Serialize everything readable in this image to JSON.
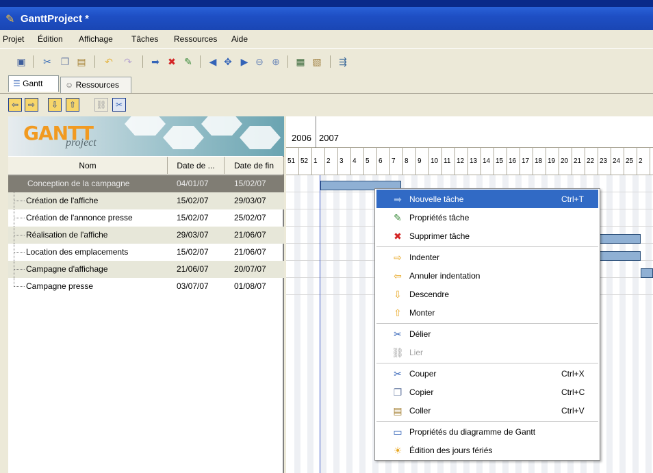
{
  "window": {
    "title": "GanttProject *"
  },
  "menu": [
    "Projet",
    "Édition",
    "Affichage",
    "Tâches",
    "Ressources",
    "Aide"
  ],
  "tabs": [
    {
      "label": "Gantt"
    },
    {
      "label": "Ressources"
    }
  ],
  "logo": {
    "brand": "GANTT",
    "sub": "project"
  },
  "table": {
    "headers": [
      "Nom",
      "Date de ...",
      "Date de fin"
    ],
    "rows": [
      {
        "name": "Conception de la campagne",
        "start": "04/01/07",
        "end": "15/02/07"
      },
      {
        "name": "Création de l'affiche",
        "start": "15/02/07",
        "end": "29/03/07"
      },
      {
        "name": "Création de l'annonce presse",
        "start": "15/02/07",
        "end": "25/02/07"
      },
      {
        "name": "Réalisation de l'affiche",
        "start": "29/03/07",
        "end": "21/06/07"
      },
      {
        "name": "Location des emplacements",
        "start": "15/02/07",
        "end": "21/06/07"
      },
      {
        "name": "Campagne d'affichage",
        "start": "21/06/07",
        "end": "20/07/07"
      },
      {
        "name": "Campagne presse",
        "start": "03/07/07",
        "end": "01/08/07"
      }
    ]
  },
  "timeline": {
    "year_prev": "2006",
    "year": "2007",
    "weeks": [
      "51",
      "52",
      "1",
      "2",
      "3",
      "4",
      "5",
      "6",
      "7",
      "8",
      "9",
      "10",
      "11",
      "12",
      "13",
      "14",
      "15",
      "16",
      "17",
      "18",
      "19",
      "20",
      "21",
      "22",
      "23",
      "24",
      "25",
      "2"
    ]
  },
  "context_menu": {
    "items": [
      {
        "label": "Nouvelle tâche",
        "shortcut": "Ctrl+T",
        "icon": "arrow-right-icon"
      },
      {
        "label": "Propriétés tâche",
        "shortcut": "",
        "icon": "task-properties-icon"
      },
      {
        "label": "Supprimer tâche",
        "shortcut": "",
        "icon": "delete-icon"
      },
      {
        "label": "Indenter",
        "shortcut": "",
        "icon": "indent-icon"
      },
      {
        "label": "Annuler indentation",
        "shortcut": "",
        "icon": "unindent-icon"
      },
      {
        "label": "Descendre",
        "shortcut": "",
        "icon": "move-down-icon"
      },
      {
        "label": "Monter",
        "shortcut": "",
        "icon": "move-up-icon"
      },
      {
        "label": "Délier",
        "shortcut": "",
        "icon": "unlink-icon"
      },
      {
        "label": "Lier",
        "shortcut": "",
        "icon": "link-icon"
      },
      {
        "label": "Couper",
        "shortcut": "Ctrl+X",
        "icon": "cut-icon"
      },
      {
        "label": "Copier",
        "shortcut": "Ctrl+C",
        "icon": "copy-icon"
      },
      {
        "label": "Coller",
        "shortcut": "Ctrl+V",
        "icon": "paste-icon"
      },
      {
        "label": "Propriétés du diagramme de Gantt",
        "shortcut": "",
        "icon": "gantt-properties-icon"
      },
      {
        "label": "Édition des jours fériés",
        "shortcut": "",
        "icon": "holidays-icon"
      }
    ]
  }
}
